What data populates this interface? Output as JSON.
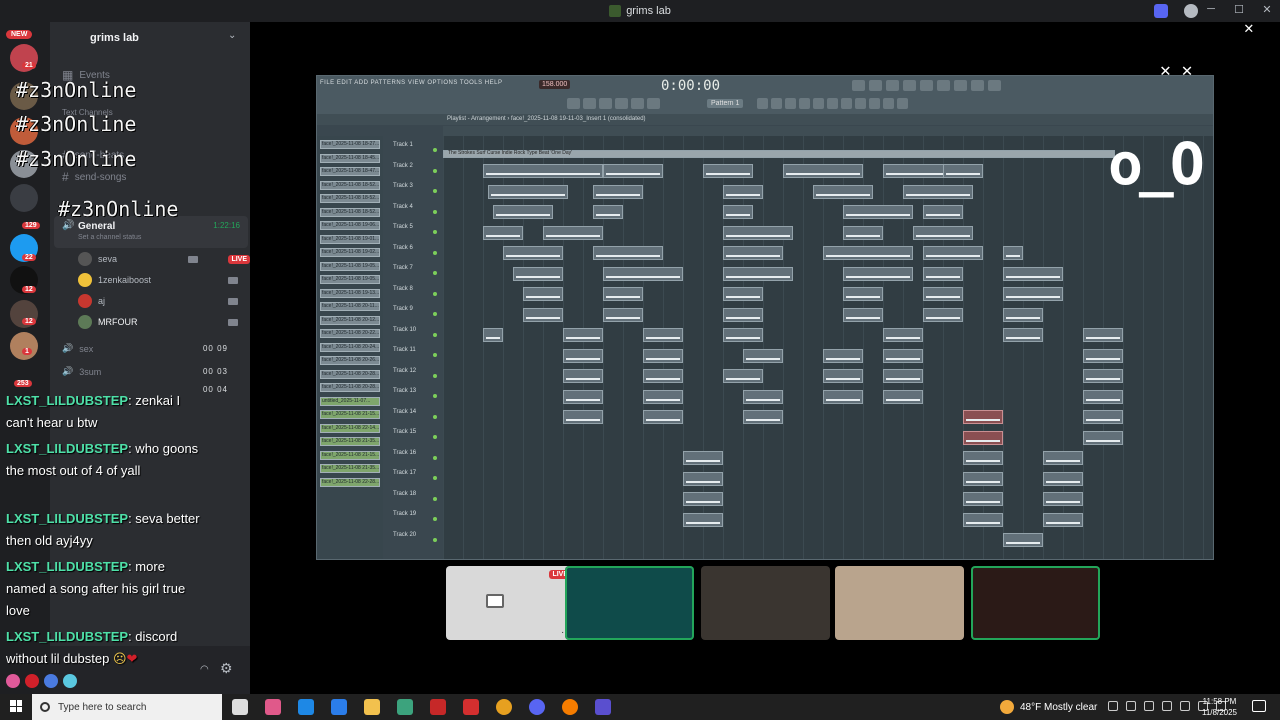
{
  "window": {
    "title": "grims lab"
  },
  "servers": {
    "new_badge": "NEW",
    "badges": [
      "21",
      "129",
      "22",
      "12",
      "12",
      "1",
      "253"
    ]
  },
  "sidebar": {
    "guild_name": "grims lab",
    "channels": [
      {
        "label": "Events"
      },
      {
        "label": "Text Channels"
      },
      {
        "label": "send-beats"
      },
      {
        "label": "send-songs"
      }
    ],
    "voice": {
      "channel": "General",
      "timer": "1:22:16",
      "status": "Set a channel status",
      "users": [
        {
          "name": "seva",
          "live": "LIVE"
        },
        {
          "name": "1zenkaiboost"
        },
        {
          "name": "aj"
        },
        {
          "name": "MRFOUR"
        }
      ],
      "other_channels": [
        {
          "name": "sex",
          "count": "00 09"
        },
        {
          "name": "3sum",
          "count": "00 03"
        },
        {
          "name": "",
          "count": "00 04"
        }
      ]
    }
  },
  "overlay": {
    "tag": "#z3nOnline",
    "face": "o_O"
  },
  "chat": {
    "messages": [
      {
        "user": "LXST_LILDUBSTEP",
        "text": ": zenkai I can't hear u btw"
      },
      {
        "user": "LXST_LILDUBSTEP",
        "text": ": who goons the most out of 4 of yall"
      },
      {
        "user": "LXST_LILDUBSTEP",
        "text": ": seva better then old ayj4yy"
      },
      {
        "user": "LXST_LILDUBSTEP",
        "text": ": more named a song after his girl true love"
      },
      {
        "user": "LXST_LILDUBSTEP",
        "text": ": discord without lil dubstep"
      }
    ],
    "emojis": [
      "pink",
      "red",
      "blue",
      "cyan"
    ]
  },
  "fl": {
    "menu": "FILE EDIT ADD PATTERNS VIEW OPTIONS TOOLS HELP",
    "bpm": "158.000",
    "time": "0:00:00",
    "pattern": "Pattern 1",
    "playlist_title": "Playlist - Arrangement › face!_2025-11-08 19-11-03_Insert 1 (consolidated)",
    "tracks": [
      "Track 1",
      "Track 2",
      "Track 3",
      "Track 4",
      "Track 5",
      "Track 6",
      "Track 7",
      "Track 8",
      "Track 9",
      "Track 10",
      "Track 11",
      "Track 12",
      "Track 13",
      "Track 14",
      "Track 15",
      "Track 16",
      "Track 17",
      "Track 18",
      "Track 19",
      "Track 20"
    ],
    "browser_clips": [
      "face!_2025-11-08 18-27...",
      "face!_2025-11-08 18-45...",
      "face!_2025-11-08 18-47...",
      "face!_2025-11-08 18-52...",
      "face!_2025-11-08 18-52...",
      "face!_2025-11-08 18-52...",
      "face!_2025-11-08 19-06...",
      "face!_2025-11-08 19-01...",
      "face!_2025-11-08 19-02...",
      "face!_2025-11-08 19-05...",
      "face!_2025-11-08 19-05...",
      "face!_2025-11-08 19-13...",
      "face!_2025-11-08 20-11...",
      "face!_2025-11-08 20-12...",
      "face!_2025-11-08 20-22...",
      "face!_2025-11-08 20-24...",
      "face!_2025-11-08 20-26...",
      "face!_2025-11-08 20-28...",
      "face!_2025-11-08 20-28...",
      "untitled_2025-11-07...",
      "face!_2025-11-08 21-15...",
      "face!_2025-11-08 22-14...",
      "face!_2025-11-08 21-35...",
      "face!_2025-11-08 21-15...",
      "face!_2025-11-08 21-35...",
      "face!_2025-11-08 22-28..."
    ],
    "top_clip": "The Strokes Surf Curse Indie Rock Type Beat 'One Day'"
  },
  "tiles": {
    "live_label": "LIVE",
    "more": "···"
  },
  "taskbar": {
    "search_placeholder": "Type here to search",
    "weather": "48°F  Mostly clear",
    "time": "11:58 PM",
    "date": "11/8/2025"
  }
}
